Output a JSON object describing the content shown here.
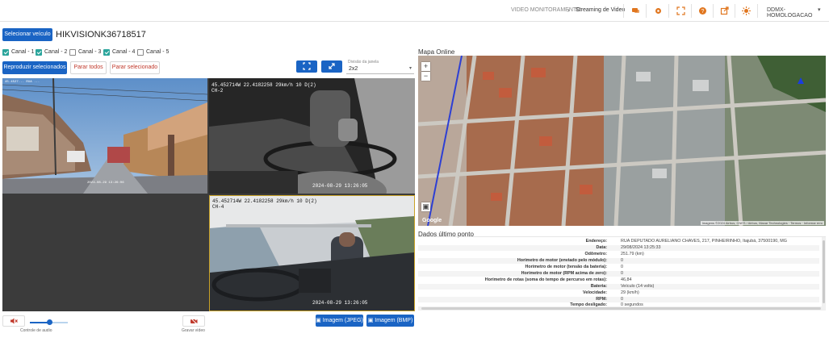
{
  "header": {
    "breadcrumb_parent": "VIDEO MONITORAMENTO",
    "breadcrumb_current": "Streaming de Video",
    "user": "DDMX-HOMOLOGACAO",
    "icons": [
      "chat-icon",
      "gear-icon",
      "fullscreen-icon",
      "help-icon",
      "external-link-icon",
      "sun-icon"
    ]
  },
  "toolbar": {
    "select_vehicle": "Selecionar veículo",
    "vehicle_name": "HIKVISIONK36718517",
    "channels": [
      {
        "label": "Canal - 1",
        "checked": true
      },
      {
        "label": "Canal - 2",
        "checked": true
      },
      {
        "label": "Canal - 3",
        "checked": false
      },
      {
        "label": "Canal - 4",
        "checked": true
      },
      {
        "label": "Canal - 5",
        "checked": false
      }
    ],
    "play_selected": "Reproduzir selecionados",
    "stop_all": "Parar todos",
    "stop_selected": "Parar selecionado",
    "division_label": "Divisão da janela",
    "division_value": "2x2"
  },
  "video": {
    "ch1": {
      "top": "45.4527... RUA ...",
      "timestamp": "2024-08-29 13:26:06"
    },
    "ch2": {
      "top": "45.452714W 22.4182258 29km/h 10 D(2)",
      "channel": "CH-2",
      "timestamp": "2024-08-29 13:26:05"
    },
    "ch4": {
      "top": "45.452714W 22.4182258 29km/h 10 D(2)",
      "channel": "CH-4",
      "timestamp": "2024-08-29 13:26:05"
    }
  },
  "map": {
    "title": "Mapa Online",
    "zoom_in": "+",
    "zoom_out": "−",
    "brand": "Google",
    "attribution": "Imagens ©2024 Airbus, CNES / Airbus, Maxar Technologies · Termos · Informar erro"
  },
  "data": {
    "title": "Dados último ponto",
    "rows": [
      {
        "label": "Endereço:",
        "value": "RUA DEPUTADO AURELIANO CHAVES, 217, PINHEIRINHO, Itajubá, 37500190, MG"
      },
      {
        "label": "Data:",
        "value": "29/08/2024 13:25:33"
      },
      {
        "label": "Odômetro:",
        "value": "251.79 (km)"
      },
      {
        "label": "Horímetro de motor (enviado pelo módulo):",
        "value": "0"
      },
      {
        "label": "Horímetro de motor (tensão da bateria):",
        "value": "0"
      },
      {
        "label": "Horímetro de motor (RPM acima de zero):",
        "value": "0"
      },
      {
        "label": "Horímetro de rotas (soma do tempo de percurso em rotas):",
        "value": "46,84"
      },
      {
        "label": "Bateria:",
        "value": "Veículo (14 volts)"
      },
      {
        "label": "Velocidade:",
        "value": "29 (km/h)"
      },
      {
        "label": "RPM:",
        "value": "0"
      },
      {
        "label": "Tempo desligado:",
        "value": "0 segundos"
      }
    ]
  },
  "controls": {
    "audio_label": "Controle de audio",
    "audio_volume_fraction": 0.5,
    "record_label": "Gravar vídeo",
    "image_jpeg": "Imagem (JPEG)",
    "image_bmp": "Imagem (BMP)"
  },
  "colors": {
    "primary": "#1a64c4",
    "accent": "#e0761f",
    "check": "#2ba59c"
  }
}
